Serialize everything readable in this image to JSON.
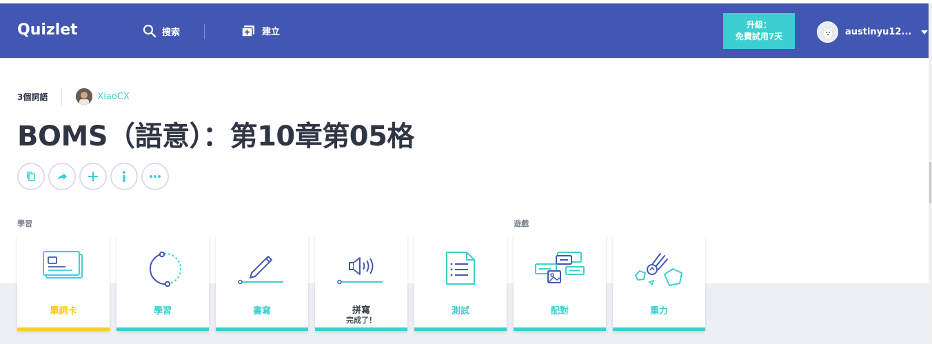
{
  "header": {
    "logo": "Quizlet",
    "search_label": "搜索",
    "create_label": "建立",
    "upgrade_line1": "升級：",
    "upgrade_line2": "免費試用7天",
    "username": "austinyu12..."
  },
  "set": {
    "term_count": "3個詞語",
    "creator": "XiaoCX",
    "title": "BOMS（語意）：第10章第05格"
  },
  "sections": {
    "study_label": "學習",
    "games_label": "遊戲"
  },
  "modes": [
    {
      "label": "單詞卡",
      "icon": "flashcards-icon"
    },
    {
      "label": "學習",
      "icon": "learn-icon"
    },
    {
      "label": "書寫",
      "icon": "write-icon"
    },
    {
      "label": "拼寫",
      "sub": "完成了！",
      "icon": "spell-icon"
    },
    {
      "label": "測試",
      "icon": "test-icon"
    },
    {
      "label": "配對",
      "icon": "match-icon"
    },
    {
      "label": "重力",
      "icon": "gravity-icon"
    }
  ],
  "colors": {
    "brand_blue": "#4257b2",
    "teal": "#3ccfcf",
    "active_yellow": "#ffcd1f"
  }
}
